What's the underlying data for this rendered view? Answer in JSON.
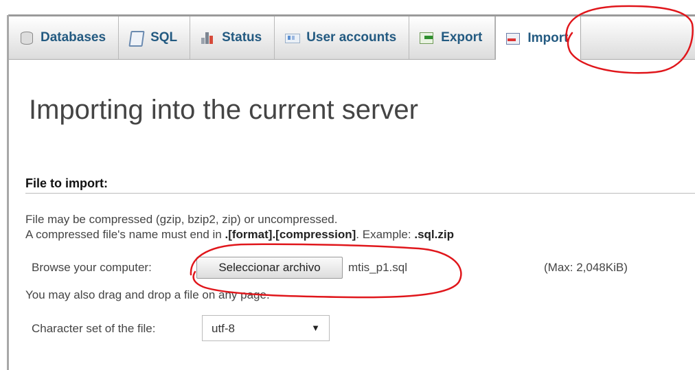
{
  "tabs": [
    {
      "label": "Databases",
      "icon": "database-icon"
    },
    {
      "label": "SQL",
      "icon": "sql-icon"
    },
    {
      "label": "Status",
      "icon": "status-icon"
    },
    {
      "label": "User accounts",
      "icon": "user-accounts-icon"
    },
    {
      "label": "Export",
      "icon": "export-icon"
    },
    {
      "label": "Import",
      "icon": "import-icon",
      "active": true
    }
  ],
  "page": {
    "title": "Importing into the current server"
  },
  "file_import": {
    "section_title": "File to import:",
    "compression_note": "File may be compressed (gzip, bzip2, zip) or uncompressed.",
    "name_note_prefix": "A compressed file's name must end in ",
    "name_note_format": ".[format].[compression]",
    "name_note_example_prefix": ". Example: ",
    "name_note_example": ".sql.zip",
    "browse_label": "Browse your computer:",
    "browse_button": "Seleccionar archivo",
    "selected_file": "mtis_p1.sql",
    "max_size": "(Max: 2,048KiB)",
    "drag_note": "You may also drag and drop a file on any page."
  },
  "charset": {
    "label": "Character set of the file:",
    "value": "utf-8"
  },
  "colors": {
    "tab_text": "#235a81",
    "annotation": "#e0161b"
  }
}
